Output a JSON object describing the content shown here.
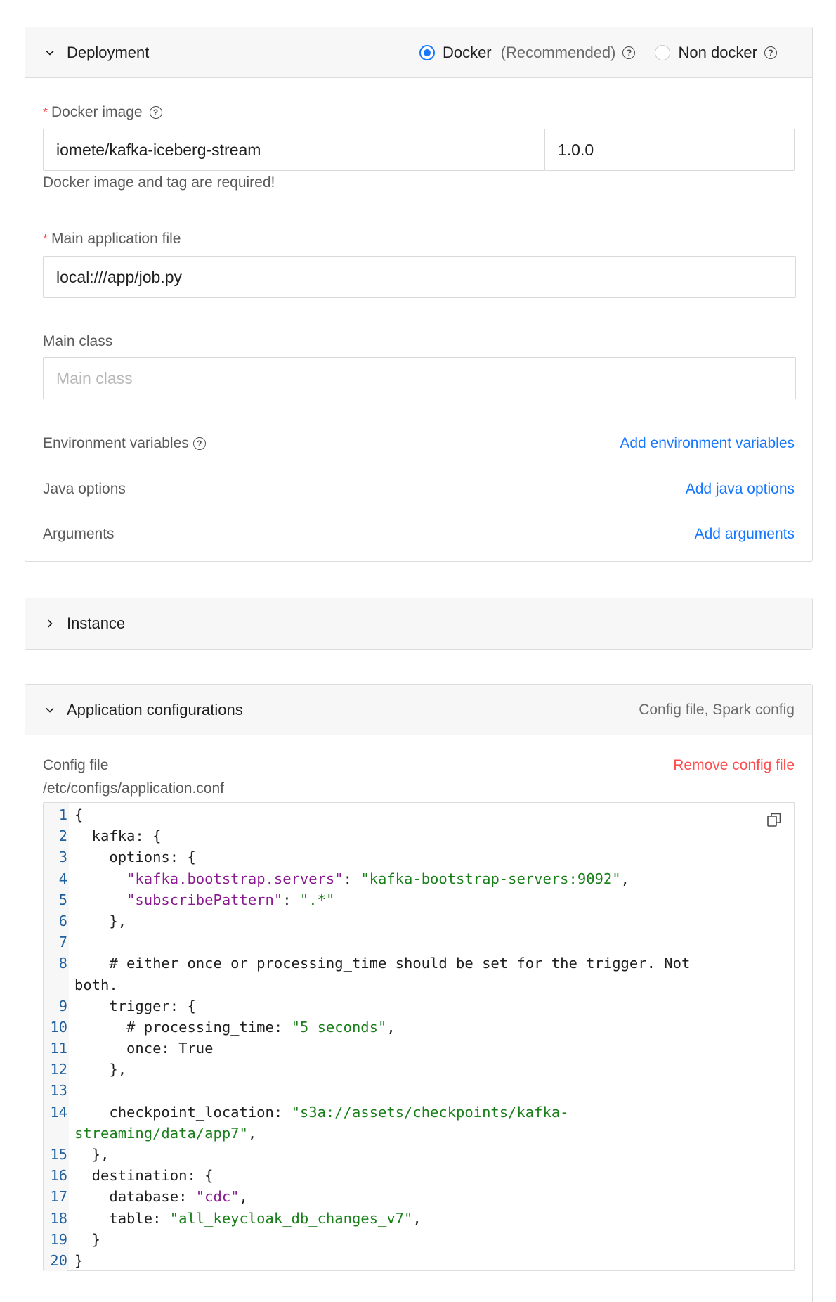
{
  "deployment": {
    "title": "Deployment",
    "options": [
      {
        "label": "Docker",
        "suffix": "(Recommended)",
        "checked": true
      },
      {
        "label": "Non docker",
        "checked": false
      }
    ],
    "docker_image_label": "Docker image",
    "docker_image_value": "iomete/kafka-iceberg-stream",
    "docker_tag_value": "1.0.0",
    "docker_hint": "Docker image and tag are required!",
    "main_app_label": "Main application file",
    "main_app_value": "local:///app/job.py",
    "main_class_label": "Main class",
    "main_class_placeholder": "Main class",
    "env_label": "Environment variables",
    "env_link": "Add environment variables",
    "java_label": "Java options",
    "java_link": "Add java options",
    "args_label": "Arguments",
    "args_link": "Add arguments"
  },
  "instance": {
    "title": "Instance"
  },
  "app_config": {
    "title": "Application configurations",
    "summary": "Config file, Spark config",
    "config_label": "Config file",
    "remove_link": "Remove config file",
    "config_path": "/etc/configs/application.conf",
    "code_lines": [
      {
        "n": "1",
        "parts": [
          [
            "p",
            "{"
          ]
        ]
      },
      {
        "n": "2",
        "parts": [
          [
            "p",
            "  kafka: {"
          ]
        ]
      },
      {
        "n": "3",
        "parts": [
          [
            "p",
            "    options: {"
          ]
        ]
      },
      {
        "n": "4",
        "parts": [
          [
            "p",
            "      "
          ],
          [
            "k",
            "\"kafka.bootstrap.servers\""
          ],
          [
            "p",
            ": "
          ],
          [
            "s",
            "\"kafka-bootstrap-servers:9092\""
          ],
          [
            "p",
            ","
          ]
        ]
      },
      {
        "n": "5",
        "parts": [
          [
            "p",
            "      "
          ],
          [
            "k",
            "\"subscribePattern\""
          ],
          [
            "p",
            ": "
          ],
          [
            "s",
            "\".*\""
          ]
        ]
      },
      {
        "n": "6",
        "parts": [
          [
            "p",
            "    },"
          ]
        ]
      },
      {
        "n": "7",
        "parts": [
          [
            "p",
            ""
          ]
        ]
      },
      {
        "n": "8",
        "parts": [
          [
            "p",
            "    # either once or processing_time should be set for the trigger. Not"
          ]
        ]
      },
      {
        "n": "",
        "parts": [
          [
            "p",
            "both."
          ]
        ]
      },
      {
        "n": "9",
        "parts": [
          [
            "p",
            "    trigger: {"
          ]
        ]
      },
      {
        "n": "10",
        "parts": [
          [
            "p",
            "      # processing_time: "
          ],
          [
            "s",
            "\"5 seconds\""
          ],
          [
            "p",
            ","
          ]
        ]
      },
      {
        "n": "11",
        "parts": [
          [
            "p",
            "      once: True"
          ]
        ]
      },
      {
        "n": "12",
        "parts": [
          [
            "p",
            "    },"
          ]
        ]
      },
      {
        "n": "13",
        "parts": [
          [
            "p",
            ""
          ]
        ]
      },
      {
        "n": "14",
        "parts": [
          [
            "p",
            "    checkpoint_location: "
          ],
          [
            "s",
            "\"s3a://assets/checkpoints/kafka-"
          ]
        ]
      },
      {
        "n": "",
        "parts": [
          [
            "s",
            "streaming/data/app7\""
          ],
          [
            "p",
            ","
          ]
        ]
      },
      {
        "n": "15",
        "parts": [
          [
            "p",
            "  },"
          ]
        ]
      },
      {
        "n": "16",
        "parts": [
          [
            "p",
            "  destination: {"
          ]
        ]
      },
      {
        "n": "17",
        "parts": [
          [
            "p",
            "    database: "
          ],
          [
            "k",
            "\"cdc\""
          ],
          [
            "p",
            ","
          ]
        ]
      },
      {
        "n": "18",
        "parts": [
          [
            "p",
            "    table: "
          ],
          [
            "s",
            "\"all_keycloak_db_changes_v7\""
          ],
          [
            "p",
            ","
          ]
        ]
      },
      {
        "n": "19",
        "parts": [
          [
            "p",
            "  }"
          ]
        ]
      },
      {
        "n": "20",
        "parts": [
          [
            "p",
            "}"
          ]
        ]
      }
    ]
  },
  "colors": {
    "accent": "#1677ff",
    "danger": "#ff4d4f",
    "string": "#1a7f1a",
    "key": "#8a1a8f"
  },
  "icons": [
    "chevron-down-icon",
    "chevron-right-icon",
    "help-icon",
    "copy-icon"
  ]
}
